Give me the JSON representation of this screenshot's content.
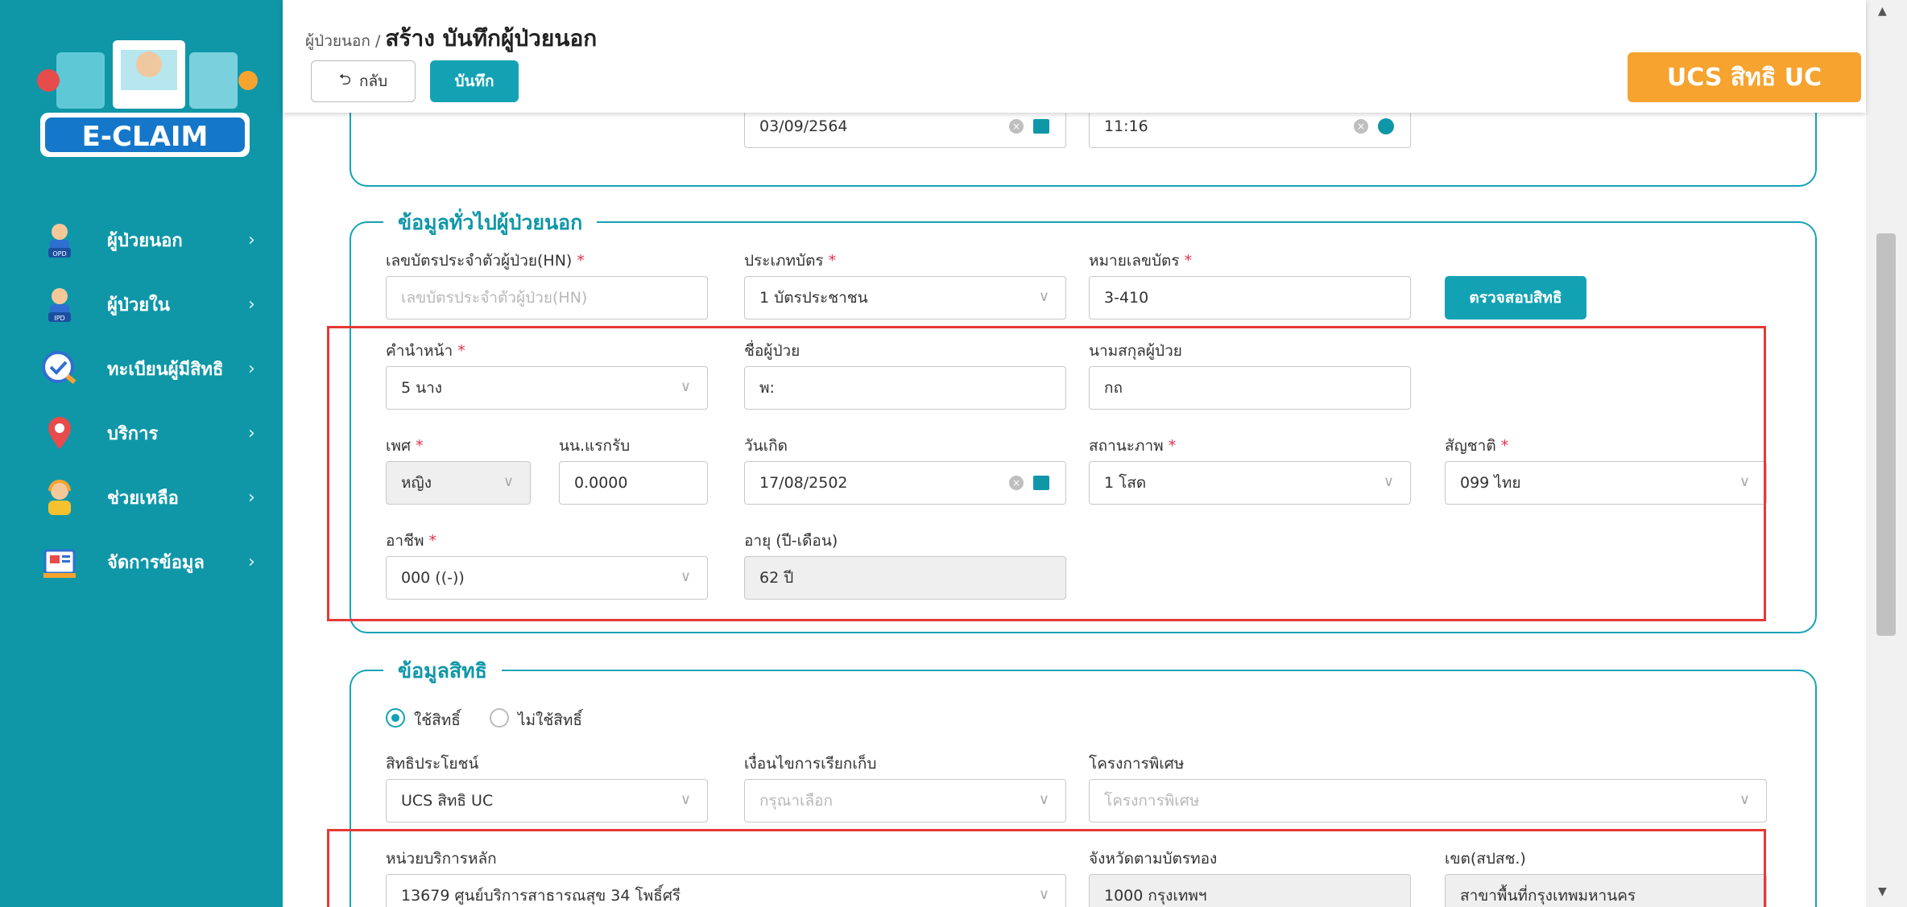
{
  "app": {
    "logo_text": "E-CLAIM"
  },
  "sidebar": {
    "items": [
      {
        "label": "ผู้ป่วยนอก",
        "icon": "opd-patient-icon"
      },
      {
        "label": "ผู้ป่วยใน",
        "icon": "ipd-patient-icon"
      },
      {
        "label": "ทะเบียนผู้มีสิทธิ",
        "icon": "registry-icon"
      },
      {
        "label": "บริการ",
        "icon": "location-pin-icon"
      },
      {
        "label": "ช่วยเหลือ",
        "icon": "helpdesk-icon"
      },
      {
        "label": "จัดการข้อมูล",
        "icon": "data-manage-icon"
      }
    ],
    "chevron": "›"
  },
  "header": {
    "breadcrumb_parent": "ผู้ป่วยนอก",
    "breadcrumb_sep": "/",
    "page_title": "สร้าง บันทึกผู้ป่วยนอก",
    "back_label": "กลับ",
    "save_label": "บันทึก",
    "rights_badge": "UCS สิทธิ UC"
  },
  "visit": {
    "date": "03/09/2564",
    "time": "11:16"
  },
  "general": {
    "title": "ข้อมูลทั่วไปผู้ป่วยนอก",
    "hn_label": "เลขบัตรประจำตัวผู้ป่วย(HN)",
    "hn_placeholder": "เลขบัตรประจำตัวผู้ป่วย(HN)",
    "card_type_label": "ประเภทบัตร",
    "card_type_value": "1 บัตรประชาชน",
    "card_no_label": "หมายเลขบัตร",
    "card_no_value": "3-410",
    "check_rights_label": "ตรวจสอบสิทธิ",
    "prefix_label": "คำนำหน้า",
    "prefix_value": "5 นาง",
    "fname_label": "ชื่อผู้ป่วย",
    "fname_value": "พ:",
    "lname_label": "นามสกุลผู้ป่วย",
    "lname_value": "กถ",
    "sex_label": "เพศ",
    "sex_value": "หญิง",
    "weight_label": "นน.แรกรับ",
    "weight_value": "0.0000",
    "dob_label": "วันเกิด",
    "dob_value": "17/08/2502",
    "marital_label": "สถานะภาพ",
    "marital_value": "1 โสด",
    "nation_label": "สัญชาติ",
    "nation_value": "099 ไทย",
    "occupation_label": "อาชีพ",
    "occupation_value": "000 ((-))",
    "age_label": "อายุ (ปี-เดือน)",
    "age_value": "62 ปี",
    "required_mark": "*"
  },
  "rights": {
    "title": "ข้อมูลสิทธิ",
    "radio_use": "ใช้สิทธิ์",
    "radio_nouse": "ไม่ใช้สิทธิ์",
    "benefit_label": "สิทธิประโยชน์",
    "benefit_value": "UCS สิทธิ UC",
    "billing_label": "เงื่อนไขการเรียกเก็บ",
    "billing_placeholder": "กรุณาเลือก",
    "project_label": "โครงการพิเศษ",
    "project_placeholder": "โครงการพิเศษ",
    "hospital_label": "หน่วยบริการหลัก",
    "hospital_value": "13679 ศูนย์บริการสาธารณสุข 34 โพธิ์ศรี",
    "province_label": "จังหวัดตามบัตรทอง",
    "province_value": "1000 กรุงเทพฯ",
    "zone_label": "เขต(สปสช.)",
    "zone_value": "สาขาพื้นที่กรุงเทพมหานคร"
  },
  "colors": {
    "primary": "#0f97a8",
    "accent": "#f6a32f",
    "highlight": "#e53935"
  }
}
